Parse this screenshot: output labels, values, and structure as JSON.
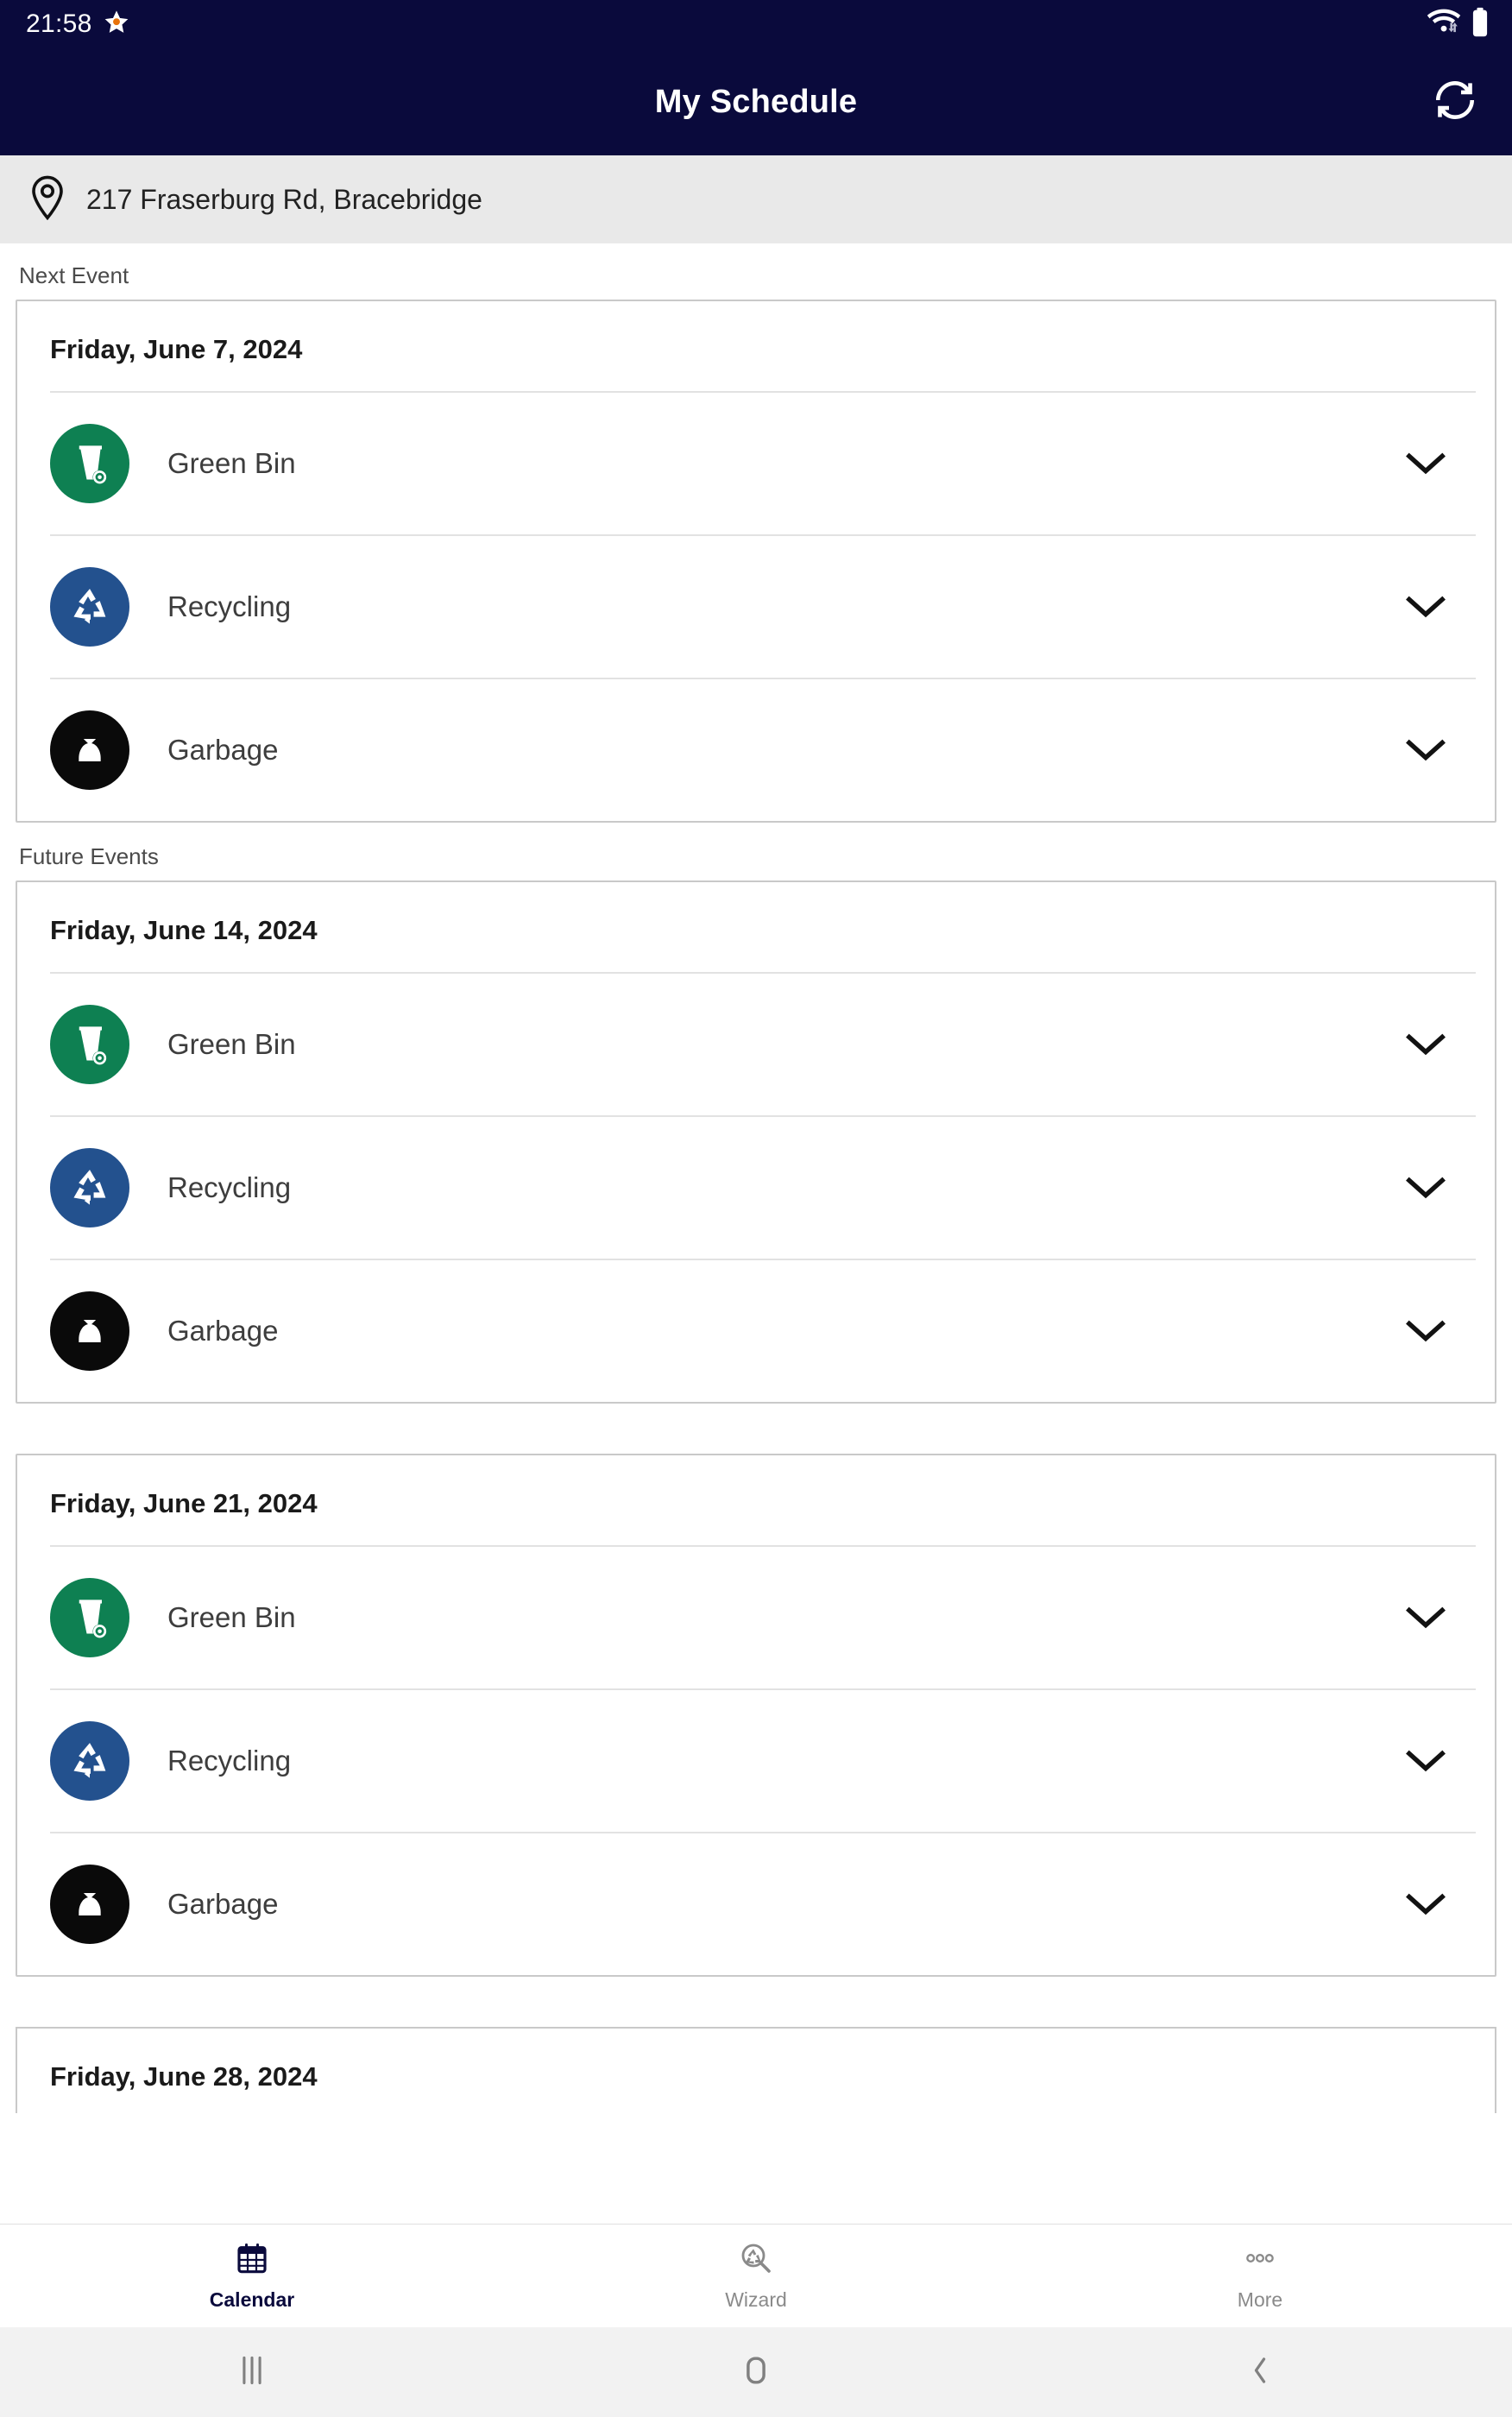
{
  "status_bar": {
    "time": "21:58",
    "icons": [
      "star-icon",
      "wifi-icon",
      "battery-icon"
    ]
  },
  "app_bar": {
    "title": "My Schedule",
    "refresh_icon": "refresh-icon"
  },
  "address_bar": {
    "icon": "location-pin-icon",
    "address": "217 Fraserburg Rd, Bracebridge"
  },
  "sections": {
    "next_event_label": "Next Event",
    "future_events_label": "Future Events"
  },
  "events": [
    {
      "date": "Friday, June 7, 2024",
      "items": [
        {
          "name": "Green Bin",
          "icon": "green-bin-icon",
          "color": "#0E8052",
          "chevron": "chevron-down-icon"
        },
        {
          "name": "Recycling",
          "icon": "recycling-icon",
          "color": "#23518E",
          "chevron": "chevron-down-icon"
        },
        {
          "name": "Garbage",
          "icon": "garbage-bag-icon",
          "color": "#0A0A0A",
          "chevron": "chevron-down-icon"
        }
      ]
    },
    {
      "date": "Friday, June 14, 2024",
      "items": [
        {
          "name": "Green Bin",
          "icon": "green-bin-icon",
          "color": "#0E8052",
          "chevron": "chevron-down-icon"
        },
        {
          "name": "Recycling",
          "icon": "recycling-icon",
          "color": "#23518E",
          "chevron": "chevron-down-icon"
        },
        {
          "name": "Garbage",
          "icon": "garbage-bag-icon",
          "color": "#0A0A0A",
          "chevron": "chevron-down-icon"
        }
      ]
    },
    {
      "date": "Friday, June 21, 2024",
      "items": [
        {
          "name": "Green Bin",
          "icon": "green-bin-icon",
          "color": "#0E8052",
          "chevron": "chevron-down-icon"
        },
        {
          "name": "Recycling",
          "icon": "recycling-icon",
          "color": "#23518E",
          "chevron": "chevron-down-icon"
        },
        {
          "name": "Garbage",
          "icon": "garbage-bag-icon",
          "color": "#0A0A0A",
          "chevron": "chevron-down-icon"
        }
      ]
    }
  ],
  "partial_event": {
    "date": "Friday, June 28, 2024"
  },
  "tab_bar": {
    "tabs": [
      {
        "label": "Calendar",
        "icon": "calendar-icon",
        "active": true
      },
      {
        "label": "Wizard",
        "icon": "search-recycle-icon",
        "active": false
      },
      {
        "label": "More",
        "icon": "more-dots-icon",
        "active": false
      }
    ]
  },
  "system_nav": {
    "recents_icon": "recents-icon",
    "home_icon": "home-icon",
    "back_icon": "back-icon"
  },
  "colors": {
    "app_bar": "#0A0A3C",
    "address_bar": "#E9E9E9",
    "green_bin": "#0E8052",
    "recycling": "#23518E",
    "garbage": "#0A0A0A",
    "card_border": "#c9c9c9"
  }
}
